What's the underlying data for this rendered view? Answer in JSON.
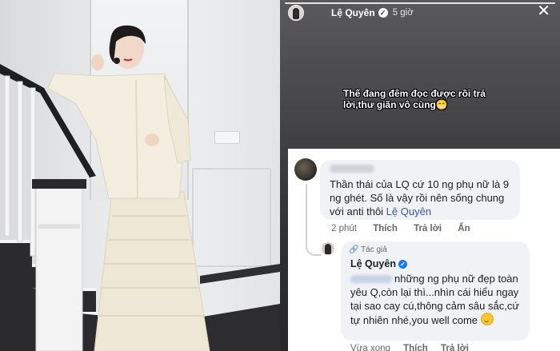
{
  "story": {
    "username": "Lệ Quyên",
    "verified_icon": "verified-badge-icon",
    "time_ago": "5 giờ",
    "close_icon": "close-icon",
    "caption": "Thế đang đêm đọc được rồi trả lời,thư giãn vô cùng😁"
  },
  "comment": {
    "text": "Thần thái của LQ cứ 10 ng phụ nữ là 9 ng ghét. Số là vậy rồi nên sống chung với anti thôi ",
    "mention": "Lệ Quyên",
    "actions": {
      "time": "2 phút",
      "like": "Thích",
      "reply": "Trả lời",
      "hide": "Ẩn"
    }
  },
  "reply": {
    "author_tag": "🔗 Tác giả",
    "author_name": "Lệ Quyên",
    "text": "những ng phụ nữ đẹp toàn yêu Q,còn lại thì...nhìn cái hiểu ngay tại sao cay cú,thông cảm sâu sắc,cứ tự nhiên nhé,you well come ",
    "actions": {
      "time": "Vừa xong",
      "like": "Thích",
      "reply": "Trả lời"
    }
  },
  "colors": {
    "facebook_blue": "#1877f2",
    "mention_blue": "#385898",
    "bubble_bg": "#f0f2f5",
    "meta_gray": "#65676b"
  }
}
